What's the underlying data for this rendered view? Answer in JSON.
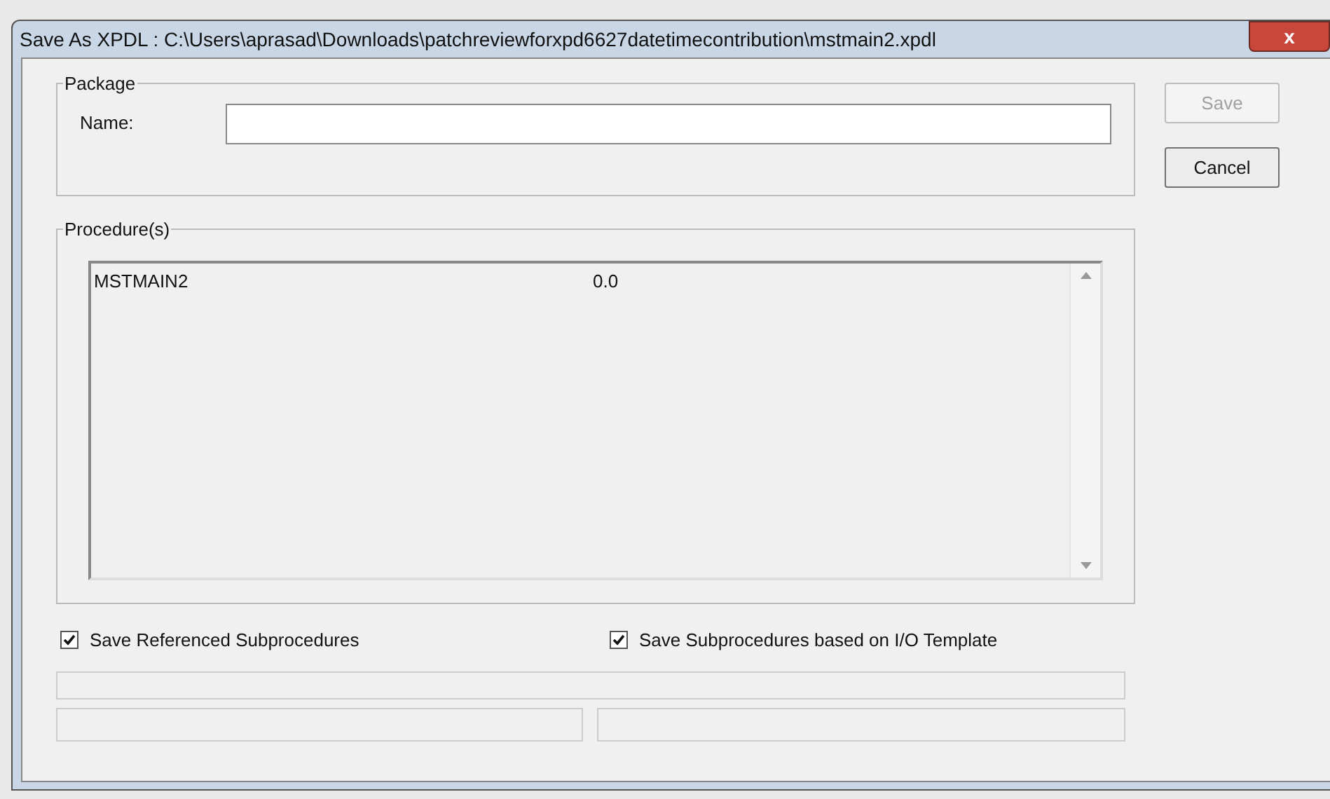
{
  "window": {
    "title": "Save As XPDL : C:\\Users\\aprasad\\Downloads\\patchreviewforxpd6627datetimecontribution\\mstmain2.xpdl",
    "close": "x"
  },
  "package": {
    "legend": "Package",
    "name_label": "Name:"
  },
  "buttons": [
    {
      "label": "Save",
      "disabled": true
    },
    {
      "label": "Cancel",
      "disabled": false
    }
  ],
  "procedures": {
    "legend": "Procedure(s)",
    "rows": [
      {
        "name": "MSTMAIN2",
        "version": "0.0"
      }
    ]
  },
  "options": [
    {
      "label": "Save Referenced Subprocedures",
      "checked": true
    },
    {
      "label": "Save Subprocedures based on I/O Template",
      "checked": true
    }
  ]
}
